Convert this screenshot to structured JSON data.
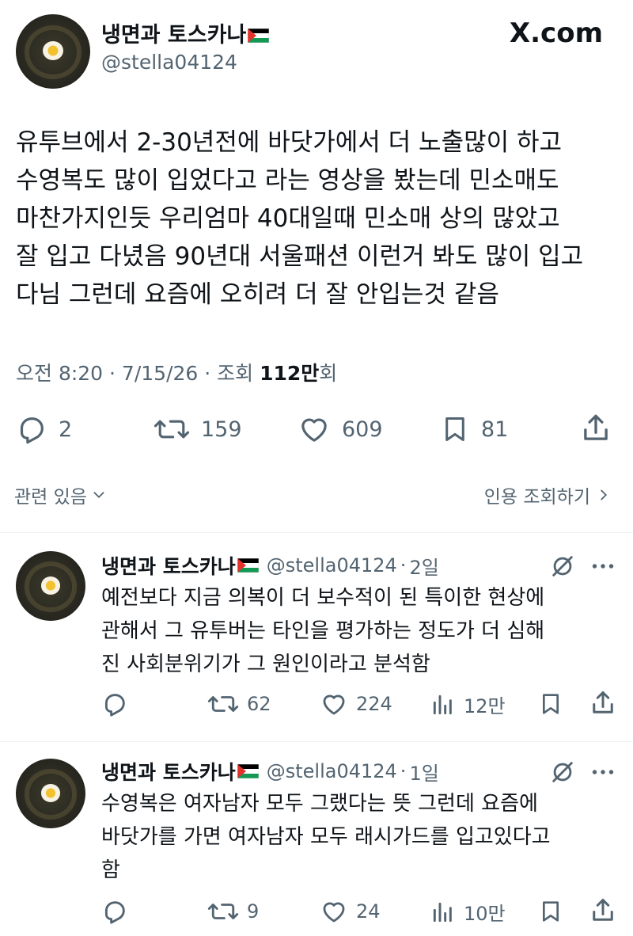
{
  "brand": {
    "logo_text": "X.com"
  },
  "main_tweet": {
    "author_name": "냉면과 토스카나",
    "handle": "@stella04124",
    "text": "유투브에서 2-30년전에 바닷가에서 더 노출많이 하고\n수영복도 많이 입었다고 라는 영상을 봤는데 민소매도\n마찬가지인듯 우리엄마 40대일때 민소매 상의 많았고\n잘 입고 다녔음 90년대 서울패션 이런거 봐도 많이 입고\n다님 그런데 요즘에 오히려 더 잘 안입는것 같음",
    "meta_prefix": "오전 8:20 · 7/15/26 · 조회 ",
    "views": "112만",
    "meta_suffix": "회",
    "replies": "2",
    "retweets": "159",
    "likes": "609",
    "bookmarks": "81"
  },
  "related_label": "관련 있음",
  "quotes_label": "인용 조회하기",
  "replies": [
    {
      "author_name": "냉면과 토스카나",
      "handle": "@stella04124",
      "sep": "·",
      "time": "2일",
      "text": "예전보다 지금 의복이 더 보수적이 된 특이한 현상에\n관해서 그 유투버는 타인을 평가하는 정도가 더 심해\n진 사회분위기가 그 원인이라고 분석함",
      "retweets": "62",
      "likes": "224",
      "views": "12만"
    },
    {
      "author_name": "냉면과 토스카나",
      "handle": "@stella04124",
      "sep": "·",
      "time": "1일",
      "text": "수영복은 여자남자 모두 그랬다는 뜻 그런데 요즘에\n바닷가를 가면 여자남자 모두 래시가드를 입고있다고\n함",
      "retweets": "9",
      "likes": "24",
      "views": "10만"
    }
  ],
  "icons": [
    "reply-icon",
    "retweet-icon",
    "like-icon",
    "bookmark-icon",
    "share-icon",
    "views-icon",
    "grok-icon",
    "more-icon",
    "chevron-down-icon",
    "chevron-right-icon",
    "palestine-flag-icon"
  ],
  "colors": {
    "text": "#0f1419",
    "secondary": "#536471",
    "divider": "#eff3f4"
  }
}
